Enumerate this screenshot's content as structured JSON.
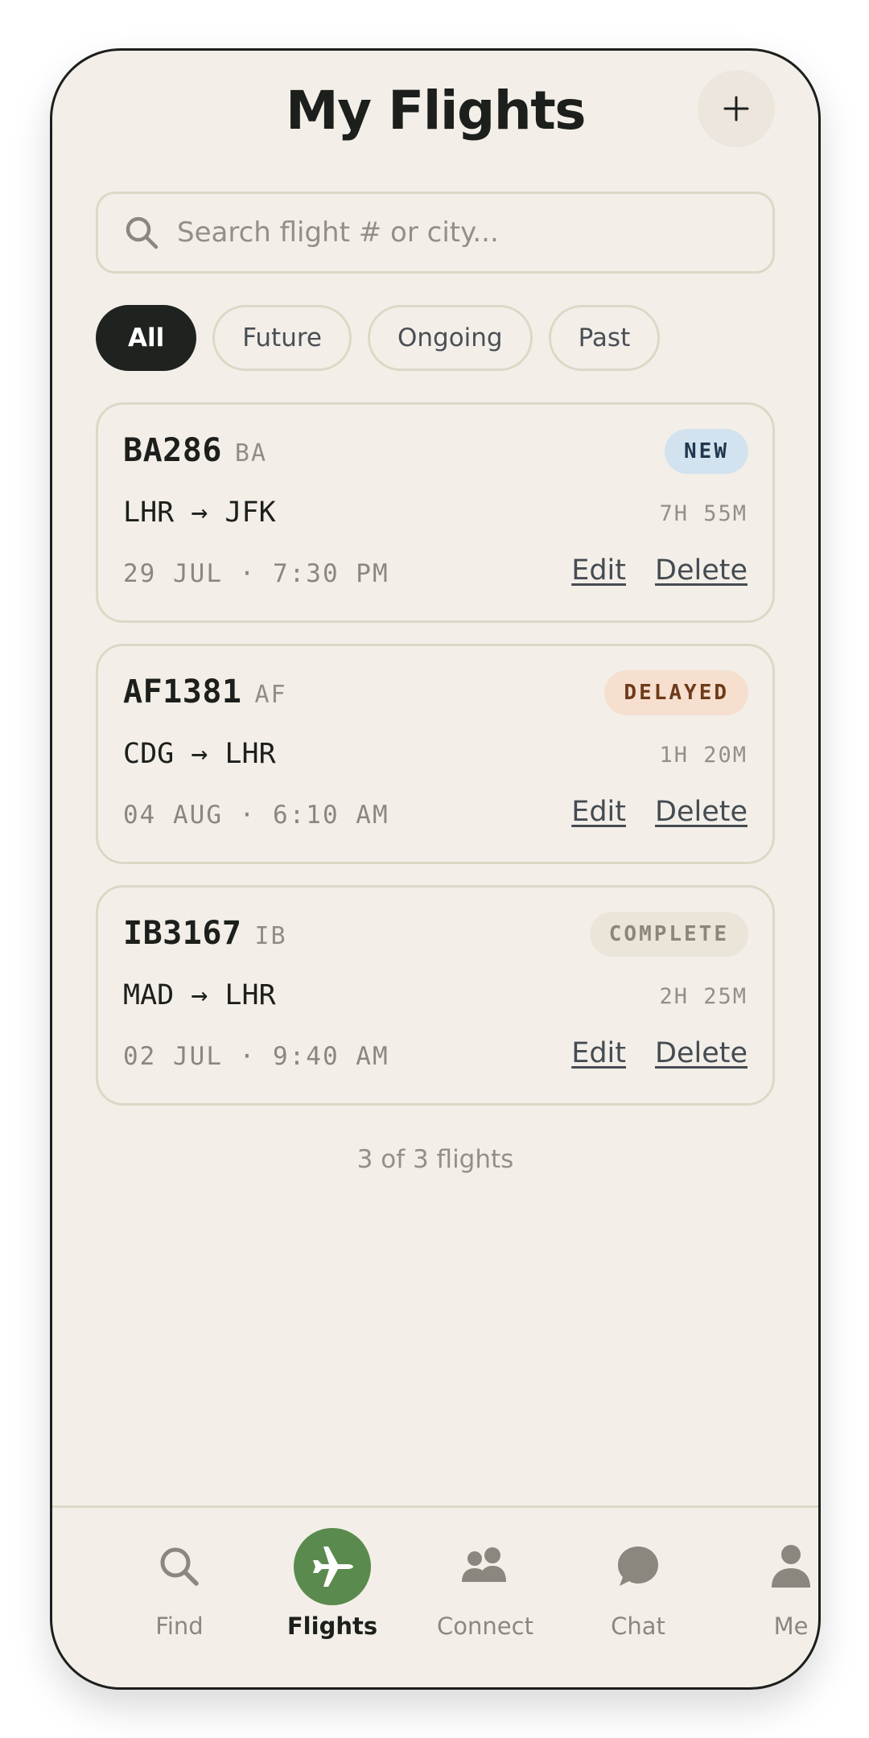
{
  "header": {
    "title": "My Flights",
    "add_label": "+"
  },
  "search": {
    "placeholder": "Search flight # or city..."
  },
  "filters": [
    "All",
    "Future",
    "Ongoing",
    "Past"
  ],
  "flights": [
    {
      "flight_no": "BA286",
      "airline": "BA",
      "badge": "NEW",
      "route": "LHR → JFK",
      "duration": "7H 55M",
      "datetime": "29 JUL · 7:30 PM",
      "edit": "Edit",
      "delete": "Delete"
    },
    {
      "flight_no": "AF1381",
      "airline": "AF",
      "badge": "DELAYED",
      "route": "CDG → LHR",
      "duration": "1H 20M",
      "datetime": "04 AUG · 6:10 AM",
      "edit": "Edit",
      "delete": "Delete"
    },
    {
      "flight_no": "IB3167",
      "airline": "IB",
      "badge": "COMPLETE",
      "route": "MAD → LHR",
      "duration": "2H 25M",
      "datetime": "02 JUL · 9:40 AM",
      "edit": "Edit",
      "delete": "Delete"
    }
  ],
  "summary": {
    "count_text": "3 of 3 flights"
  },
  "tabbar": {
    "items": [
      {
        "label": "Find",
        "icon": "search-icon"
      },
      {
        "label": "Flights",
        "icon": "airplane-icon"
      },
      {
        "label": "Connect",
        "icon": "people-icon"
      },
      {
        "label": "Chat",
        "icon": "chat-bubble-icon"
      },
      {
        "label": "Me",
        "icon": "person-icon"
      }
    ]
  },
  "colors": {
    "background": "#f3efe8",
    "ink": "#1c1f1c",
    "accent_green": "#5b8a4e",
    "badge_new": "#d2e3ef",
    "badge_delayed": "#f6dfcf",
    "badge_complete": "#ebe5d9"
  }
}
